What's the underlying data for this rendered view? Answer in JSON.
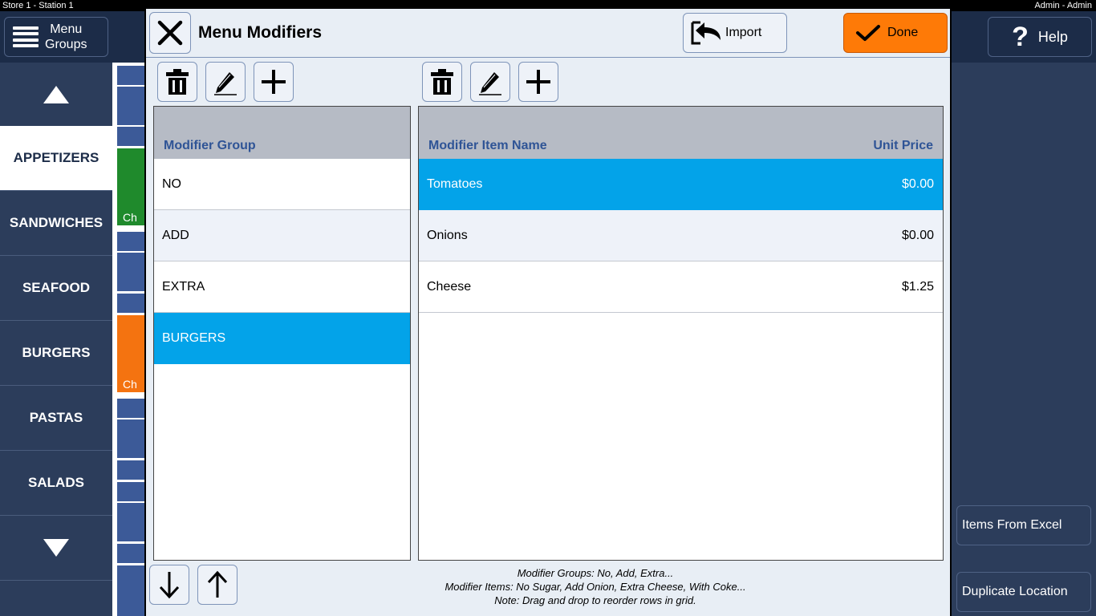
{
  "statusbar": {
    "left": "Store 1 - Station 1",
    "right": "Admin - Admin"
  },
  "header": {
    "menu_groups_line1": "Menu",
    "menu_groups_line2": "Groups",
    "help_label": "Help"
  },
  "sidebar": {
    "categories": [
      {
        "label": "APPETIZERS",
        "active": true
      },
      {
        "label": "SANDWICHES"
      },
      {
        "label": "SEAFOOD"
      },
      {
        "label": "BURGERS"
      },
      {
        "label": "PASTAS"
      },
      {
        "label": "SALADS"
      }
    ]
  },
  "tiles": {
    "tile_text_1": "Ch",
    "tile_text_2": "Ch"
  },
  "right_panel": {
    "items_from_excel": "Items From Excel",
    "duplicate_location": "Duplicate Location"
  },
  "dialog": {
    "title": "Menu Modifiers",
    "import_label": "Import",
    "done_label": "Done",
    "groups": {
      "header": "Modifier Group",
      "rows": [
        "NO",
        "ADD",
        "EXTRA",
        "BURGERS"
      ],
      "selected_index": 3
    },
    "items": {
      "header_name": "Modifier Item Name",
      "header_price": "Unit Price",
      "rows": [
        {
          "name": "Tomatoes",
          "price": "$0.00"
        },
        {
          "name": "Onions",
          "price": "$0.00"
        },
        {
          "name": "Cheese",
          "price": "$1.25"
        }
      ],
      "selected_index": 0
    },
    "notes": {
      "line1": "Modifier Groups: No, Add, Extra...",
      "line2": "Modifier Items: No Sugar, Add Onion, Extra Cheese, With Coke...",
      "line3": "Note: Drag and drop to reorder rows in grid."
    }
  },
  "colors": {
    "accent_selected": "#03a3e9",
    "done_orange": "#fe7a07",
    "header_text_blue": "#2f5496"
  }
}
